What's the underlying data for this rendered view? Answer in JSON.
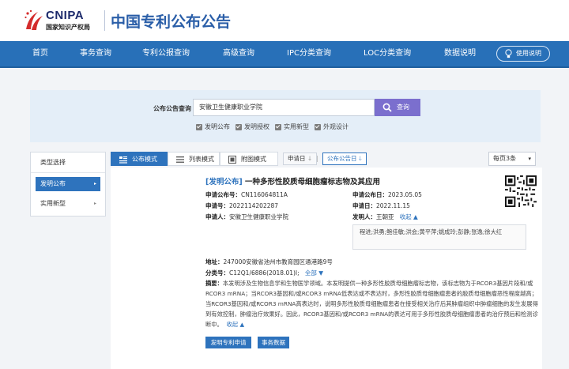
{
  "header": {
    "logo_en": "CNIPA",
    "logo_cn": "国家知识产权局",
    "site_title": "中国专利公布公告"
  },
  "nav": {
    "items": [
      "首页",
      "事务查询",
      "专利公报查询",
      "高级查询",
      "IPC分类查询",
      "LOC分类查询",
      "数据说明"
    ],
    "help_label": "使用说明"
  },
  "search": {
    "label": "公布公告查询",
    "value": "安徽卫生健康职业学院",
    "button_label": "查询",
    "checkboxes": [
      {
        "label": "发明公布",
        "checked": true
      },
      {
        "label": "发明授权",
        "checked": true
      },
      {
        "label": "实用新型",
        "checked": true
      },
      {
        "label": "外观设计",
        "checked": true
      }
    ]
  },
  "sidebar": {
    "title": "类型选择",
    "items": [
      {
        "label": "发明公布",
        "active": true
      },
      {
        "label": "实用新型",
        "active": false
      }
    ]
  },
  "toolbar": {
    "tabs": [
      "公布模式",
      "列表模式",
      "附图模式"
    ],
    "sort_options": [
      "申请日",
      "公布公告日"
    ],
    "per_page": "每页3条"
  },
  "result": {
    "tag": "[发明公布]",
    "title": "一种多形性胶质母细胞瘤标志物及其应用",
    "fields": {
      "app_no_label": "申请公布号：",
      "app_no": "CN116064811A",
      "app_date_label": "申请公布日：",
      "app_date": "2023.05.05",
      "apply_no_label": "申请号：",
      "apply_no": "2022114202287",
      "apply_date_label": "申请日：",
      "apply_date": "2022.11.15",
      "applicant_label": "申请人：",
      "applicant": "安徽卫生健康职业学院",
      "inventor_label": "发明人：",
      "inventor": "王朝亚",
      "collapse_label": "收起 ▲",
      "address_label": "地址：",
      "address": "247000安徽省池州市教育园区通港路9号",
      "class_label": "分类号：",
      "class_no": "C12Q1/6886(2018.01)I;",
      "all_label": "全部 ▼",
      "abstract_label": "摘要："
    },
    "inventors_full": "程进;洪勇;鲍佳敏;洪会;黄平萍;姚成玲;彭静;张逸;徐大红",
    "abstract": "本发明涉及生物信息学和生物医学领域。本发明提供一种多形性胶质母细胞瘤标志物，该标志物为于RCOR3基因片段和/或RCOR3 mRNA；当RCOR3基因和/或RCOR3 mRNA低表达或不表达时，多形性胶质母细胞瘤患者的胶质母细胞瘤恶性程度越高；当RCOR3基因和/或RCOR3 mRNA高表达时，说明多形性胶质母细胞瘤患者在接受相关治疗后其肿瘤组织中肿瘤细胞的发生发展得到有效控制，肿瘤治疗效果好。因此，RCOR3基因和/或RCOR3 mRNA的表达可用于多形性胶质母细胞瘤患者的治疗预后和检测诊断中。",
    "abstract_collapse": "收起 ▲",
    "buttons": [
      "发明专利申请",
      "事务数据"
    ]
  },
  "colors": {
    "nav_bg": "#2870b8",
    "accent": "#2e73bd",
    "search_button": "#7b6fce",
    "title_blue": "#2a5ea8"
  }
}
